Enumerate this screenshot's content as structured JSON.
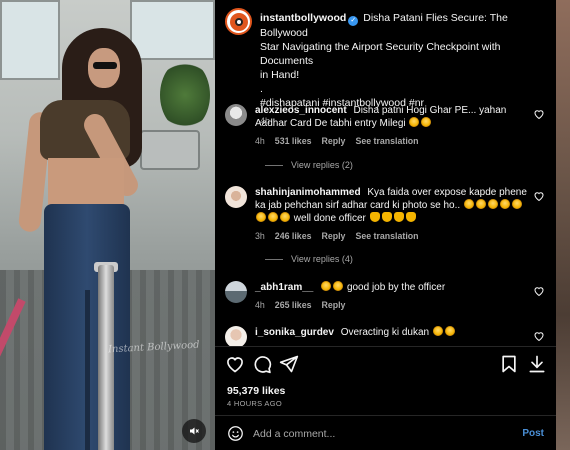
{
  "post": {
    "username": "instantbollywood",
    "caption_lines": [
      "Disha Patani Flies Secure: The Bollywood",
      "Star Navigating the Airport Security Checkpoint with Documents",
      "in Hand!",
      ".",
      "#dishapatani #instantbollywood #nr"
    ],
    "time": "4h"
  },
  "photo": {
    "watermark": "Instant Bollywood"
  },
  "comments": [
    {
      "username": "alexzieos_innocent",
      "text": "Disha patni Hogi Ghar PE... yahan Aadhar Card De tabhi entry Milegi",
      "time": "4h",
      "likes": "531 likes",
      "reply": "Reply",
      "translation": "See translation",
      "view_replies": "View replies (2)"
    },
    {
      "username": "shahinjanimohammed",
      "text": "Kya faida over expose kapde phene ka jab pehchan sirf adhar card ki photo se ho..",
      "text2": "well done officer",
      "time": "3h",
      "likes": "246 likes",
      "reply": "Reply",
      "translation": "See translation",
      "view_replies": "View replies (4)"
    },
    {
      "username": "_abh1ram__",
      "text": "good job by the officer",
      "time": "4h",
      "likes": "265 likes",
      "reply": "Reply"
    },
    {
      "username": "i_sonika_gurdev",
      "text": "Overacting ki dukan"
    }
  ],
  "footer": {
    "likes": "95,379 likes",
    "ago": "4 HOURS AGO",
    "placeholder": "Add a comment...",
    "post_label": "Post"
  },
  "icons": {
    "like": "heart-icon",
    "comment": "comment-icon",
    "share": "send-icon",
    "save": "bookmark-icon",
    "download": "download-icon",
    "emoji": "smiley-icon",
    "mute": "speaker-muted-icon"
  },
  "colors": {
    "accent_orange": "#e0561d",
    "verified_blue": "#3897f0",
    "post_link": "#4a8fd6"
  }
}
